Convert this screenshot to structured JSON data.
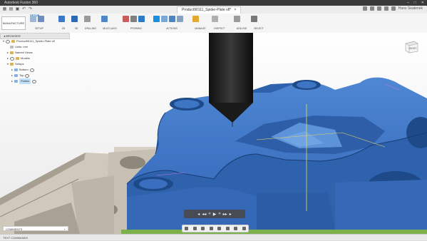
{
  "window": {
    "title": "Autodesk Fusion 360"
  },
  "tabbar": {
    "document_tab": "Product90111_Spider-Plate v8*",
    "user": "Hans Seatenek"
  },
  "ribbon": {
    "workspace": "MANUFACTURE",
    "active_tab": "SETUP",
    "groups": [
      "SETUP",
      "2D",
      "3D",
      "DRILLING",
      "MULTI-AXIS",
      "PROBING",
      "ACTIONS",
      "MANAGE",
      "INSPECT",
      "ADD-INS",
      "SELECT"
    ]
  },
  "browser": {
    "header": "BROWSER",
    "items": [
      {
        "label": "Product90111_Spider-Plate v8",
        "level": 0
      },
      {
        "label": "Units: mm",
        "level": 1
      },
      {
        "label": "Named Views",
        "level": 1
      },
      {
        "label": "Models",
        "level": 1
      },
      {
        "label": "Setups",
        "level": 1
      },
      {
        "label": "Bottom",
        "level": 2
      },
      {
        "label": "Top",
        "level": 2
      },
      {
        "label": "Flatten",
        "level": 2,
        "selected": true
      }
    ]
  },
  "viewcube": {
    "label": "RIGHT"
  },
  "comments": {
    "label": "COMMENTS"
  },
  "text_commands": {
    "label": "TEXT COMMANDS"
  },
  "colors": {
    "part": "#3f77c8",
    "tool": "#1c1c1c",
    "fixture": "#c9c1b4",
    "ground": "#7cb04a"
  }
}
